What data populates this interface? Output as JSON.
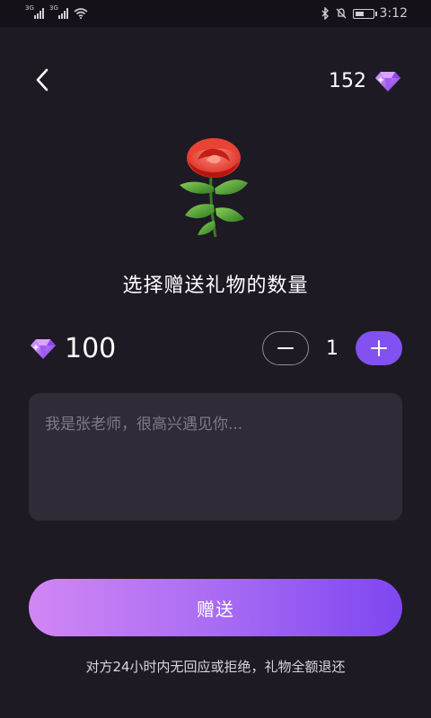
{
  "status_bar": {
    "signal_1_tag": "3G",
    "signal_2_tag": "3G",
    "time": "3:12",
    "icons": [
      "signal-icon",
      "signal-icon",
      "wifi-icon",
      "bluetooth-icon",
      "mute-icon",
      "battery-icon"
    ],
    "battery_level": 0.55
  },
  "header": {
    "back_icon": "chevron-left-icon",
    "balance": "152",
    "balance_icon": "diamond-icon"
  },
  "gift": {
    "image_icon": "rose-icon"
  },
  "title": "选择赠送礼物的数量",
  "price": {
    "value": "100",
    "icon": "diamond-icon"
  },
  "stepper": {
    "quantity": "1",
    "minus_icon": "minus-icon",
    "plus_icon": "plus-icon"
  },
  "message": {
    "placeholder": "我是张老师，很高兴遇见你...",
    "value": ""
  },
  "send_button": {
    "label": "赠送"
  },
  "footnote": "对方24小时内无回应或拒绝，礼物全额退还",
  "colors": {
    "background": "#1d1a24",
    "accent": "#8251f0",
    "gradient_start": "#d286f5",
    "gradient_end": "#7e46f0"
  }
}
